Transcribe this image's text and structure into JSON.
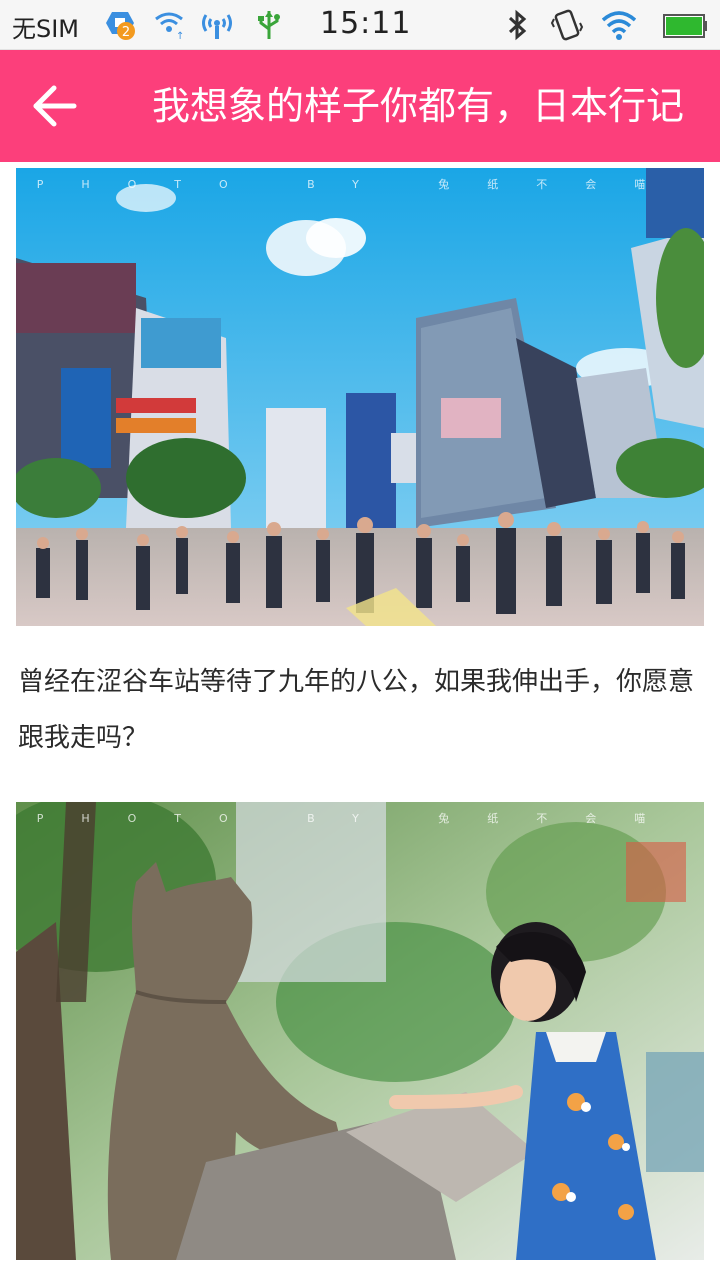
{
  "status_bar": {
    "carrier": "无SIM",
    "notification_badge": "2",
    "time": "15:11",
    "icons": [
      "notification-badge-icon",
      "wifi-hotspot-icon",
      "wifi-signal-icon",
      "usb-icon",
      "bluetooth-icon",
      "vibrate-icon",
      "wifi-icon",
      "battery-icon"
    ]
  },
  "header": {
    "title": "我想象的样子你都有，日本行记",
    "back_icon": "back-arrow-icon"
  },
  "article": {
    "photo1": {
      "watermark": "PHOTO BY 兔纸不会喵",
      "subject": "shibuya-crossing-photo"
    },
    "paragraph1": "曾经在涩谷车站等待了九年的八公，如果我伸出手，你愿意跟我走吗？",
    "photo2": {
      "watermark": "PHOTO BY 兔纸不会喵",
      "subject": "hachiko-statue-photo"
    }
  },
  "colors": {
    "accent": "#fc3f7b",
    "status_bar_bg": "#f6f6f6",
    "text": "#2b2b2b"
  }
}
